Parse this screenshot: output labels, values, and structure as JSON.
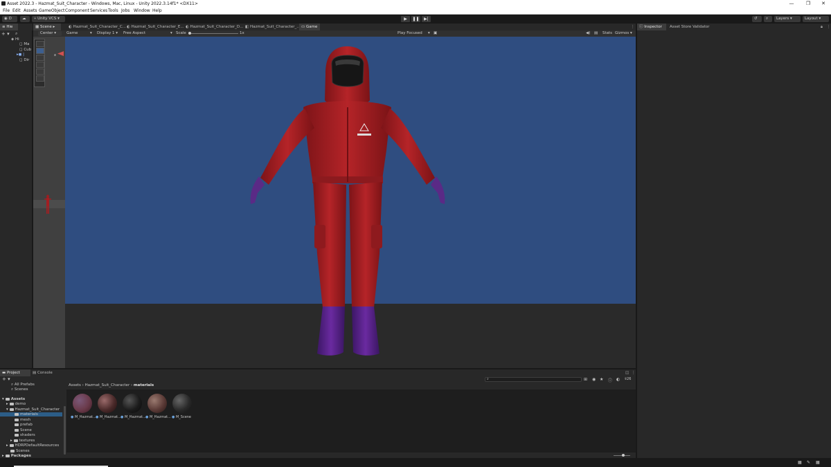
{
  "window": {
    "title": "Asset 2022.3 - Hazmat_Suit_Character - Windows, Mac, Linux - Unity 2022.3.14f1* <DX11>",
    "minimize": "—",
    "maximize": "❐",
    "close": "✕"
  },
  "menu": [
    "File",
    "Edit",
    "Assets",
    "GameObject",
    "Component",
    "Services",
    "Tools",
    "Jobs",
    "Window",
    "Help"
  ],
  "toolbar": {
    "account": "D",
    "vcs": "Unity VCS",
    "layers": "Layers",
    "layout": "Layout"
  },
  "hierarchy": {
    "tab": "Hie",
    "items": [
      "Hi",
      "Ma",
      "Cub",
      "|",
      "Dir"
    ]
  },
  "scene": {
    "tab": "Scene",
    "center": "Center",
    "axis_x": "x"
  },
  "center_tabs": [
    {
      "label": "Hazmat_Suit_Character_C..."
    },
    {
      "label": "Hazmat_Suit_Character_E..."
    },
    {
      "label": "Hazmat_Suit_Character_D..."
    },
    {
      "label": "Hazmat_Suit_Character_..."
    },
    {
      "label": "Game"
    }
  ],
  "game": {
    "mode": "Game",
    "display": "Display 1",
    "aspect": "Free Aspect",
    "scale_label": "Scale",
    "scale_value": "1x",
    "play_focused": "Play Focused",
    "stats": "Stats",
    "gizmos": "Gizmos"
  },
  "inspector": {
    "tab": "Inspector",
    "tab2": "Asset Store Validator"
  },
  "project": {
    "tab": "Project",
    "tab2": "Console",
    "favorites": [
      "All Prefabs",
      "Scenes"
    ],
    "tree": [
      {
        "label": "Assets",
        "indent": 0,
        "bold": true
      },
      {
        "label": "demo",
        "indent": 1
      },
      {
        "label": "Hazmat_Suit_Character",
        "indent": 1
      },
      {
        "label": "materials",
        "indent": 2,
        "selected": true
      },
      {
        "label": "mesh",
        "indent": 2
      },
      {
        "label": "prefab",
        "indent": 2
      },
      {
        "label": "Scene",
        "indent": 2
      },
      {
        "label": "shaders",
        "indent": 2
      },
      {
        "label": "textures",
        "indent": 2
      },
      {
        "label": "HDRPDefaultResources",
        "indent": 1
      },
      {
        "label": "Scenes",
        "indent": 1
      },
      {
        "label": "Packages",
        "indent": 0,
        "bold": true
      }
    ],
    "breadcrumb": [
      "Assets",
      "Hazmat_Suit_Character",
      "materials"
    ],
    "hidden_count": "26",
    "assets": [
      {
        "label": "M_Hazmat...",
        "color": "#6a3a4a"
      },
      {
        "label": "M_Hazmat...",
        "color": "#4a2a2a"
      },
      {
        "label": "M_Hazmat...",
        "color": "#1c1c1c"
      },
      {
        "label": "M_Hazmat...",
        "color": "#5a3a36"
      },
      {
        "label": "M_Scene",
        "color": "#2a2a2a"
      }
    ]
  },
  "colors": {
    "game_bg": "#2f4d80",
    "suit": "#a31e22",
    "gloves": "#5a2a86"
  }
}
